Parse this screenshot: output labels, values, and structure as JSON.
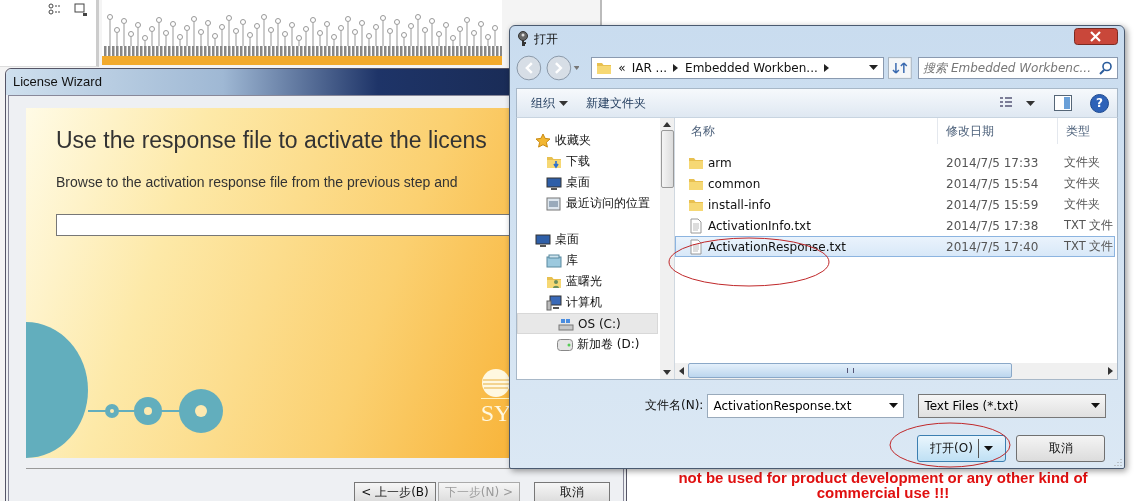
{
  "background_window": {
    "notice": [
      "not be used for product development or any other kind of",
      "commercial use !!!"
    ]
  },
  "wizard": {
    "title": "License Wizard",
    "heading": "Use the response file to activate the licens",
    "description": "Browse to the activation response file from the previous step and",
    "logo_text": "SY",
    "buttons": [
      {
        "label": "< 上一步(B)",
        "disabled": false
      },
      {
        "label": "下一步(N) >",
        "disabled": true
      },
      {
        "label": "取消",
        "disabled": false
      }
    ]
  },
  "dialog": {
    "title": "打开",
    "address": {
      "overflow_mark": "«",
      "crumbs": [
        "IAR ...",
        "Embedded Workben..."
      ]
    },
    "search": {
      "placeholder": "搜索 Embedded Workbenc..."
    },
    "toolbar": {
      "organize": "组织",
      "new_folder": "新建文件夹",
      "help": "?"
    },
    "nav": [
      {
        "label": "收藏夹",
        "kind": "favorites",
        "selected": false,
        "children": [
          {
            "label": "下载",
            "kind": "downloads",
            "selected": false
          },
          {
            "label": "桌面",
            "kind": "desktop",
            "selected": false
          },
          {
            "label": "最近访问的位置",
            "kind": "recent",
            "selected": false
          }
        ]
      },
      {
        "label": "桌面",
        "kind": "desktop",
        "selected": false,
        "children": [
          {
            "label": "库",
            "kind": "library",
            "selected": false
          },
          {
            "label": "蓝曙光",
            "kind": "user",
            "selected": false
          },
          {
            "label": "计算机",
            "kind": "computer",
            "selected": false,
            "children": [
              {
                "label": "OS (C:)",
                "kind": "system-drive",
                "selected": true
              },
              {
                "label": "新加卷 (D:)",
                "kind": "drive",
                "selected": false
              }
            ]
          }
        ]
      }
    ],
    "columns": [
      "名称",
      "修改日期",
      "类型"
    ],
    "rows": [
      {
        "name": "arm",
        "modified": "2014/7/5 17:33",
        "type": "文件夹",
        "kind": "folder",
        "selected": false
      },
      {
        "name": "common",
        "modified": "2014/7/5 15:54",
        "type": "文件夹",
        "kind": "folder",
        "selected": false
      },
      {
        "name": "install-info",
        "modified": "2014/7/5 15:59",
        "type": "文件夹",
        "kind": "folder",
        "selected": false
      },
      {
        "name": "ActivationInfo.txt",
        "modified": "2014/7/5 17:38",
        "type": "TXT 文件",
        "kind": "file",
        "selected": false
      },
      {
        "name": "ActivationResponse.txt",
        "modified": "2014/7/5 17:40",
        "type": "TXT 文件",
        "kind": "file",
        "selected": true
      }
    ],
    "filename": {
      "label": "文件名(N):",
      "value": "ActivationResponse.txt"
    },
    "filter": {
      "value": "Text Files (*.txt)"
    },
    "buttons": {
      "open": "打开(O)",
      "cancel": "取消"
    }
  }
}
